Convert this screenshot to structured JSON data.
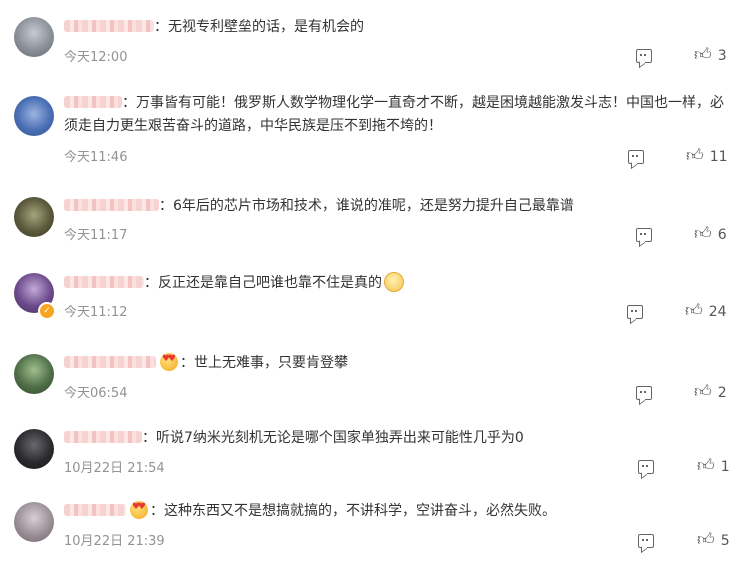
{
  "comments": [
    {
      "text": "：无视专利壁垒的话，是有机会的",
      "time": "今天12:00",
      "likes": "3",
      "avatar_color": "#8a8f99"
    },
    {
      "text": "：万事皆有可能！俄罗斯人数学物理化学一直奇才不断，越是困境越能激发斗志！中国也一样，必须走自力更生艰苦奋斗的道路，中华民族是压不到拖不垮的！",
      "time": "今天11:46",
      "likes": "11",
      "avatar_color": "#4a6fb5"
    },
    {
      "text": "：6年后的芯片市场和技术，谁说的准呢，还是努力提升自己最靠谱",
      "time": "今天11:17",
      "likes": "6",
      "avatar_color": "#5b5a3c"
    },
    {
      "text": "：反正还是靠自己吧谁也靠不住是真的",
      "time": "今天11:12",
      "likes": "24",
      "avatar_color": "#6b4a8a",
      "verified": true
    },
    {
      "text": "：世上无难事，只要肯登攀",
      "time": "今天06:54",
      "likes": "2",
      "avatar_color": "#4f6e48"
    },
    {
      "text": "：听说7纳米光刻机无论是哪个国家单独弄出来可能性几乎为0",
      "time": "10月22日 21:54",
      "likes": "1",
      "avatar_color": "#2b2b2e"
    },
    {
      "text": "：这种东西又不是想搞就搞的，不讲科学，空讲奋斗，必然失败。",
      "time": "10月22日 21:39",
      "likes": "5",
      "avatar_color": "#9a8f96"
    }
  ],
  "icons": {
    "comment": "comment-icon",
    "like": "thumbs-up-icon",
    "verified": "verified-badge-icon",
    "emoji": "emoji-icon"
  },
  "colors": {
    "username_blur": "#f6d2d0",
    "timestamp": "#939393",
    "text": "#333333"
  }
}
